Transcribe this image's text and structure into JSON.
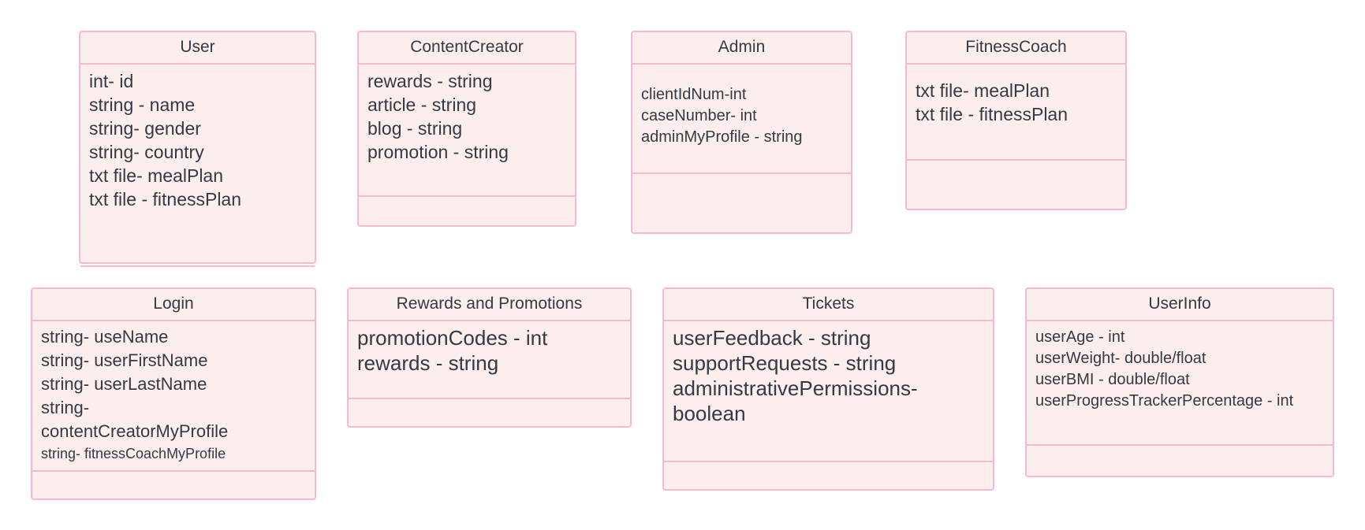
{
  "diagram": {
    "classes": {
      "user": {
        "name": "User",
        "attributes": [
          "int- id",
          "string - name",
          "string- gender",
          "string- country",
          "txt file- mealPlan",
          "txt file - fitnessPlan"
        ]
      },
      "content_creator": {
        "name": "ContentCreator",
        "attributes": [
          "rewards - string",
          "article - string",
          "blog - string",
          "promotion - string"
        ]
      },
      "admin": {
        "name": "Admin",
        "attributes": [
          "clientIdNum-int",
          "caseNumber- int",
          "adminMyProfile - string"
        ]
      },
      "fitness_coach": {
        "name": "FitnessCoach",
        "attributes": [
          "txt file- mealPlan",
          "txt file - fitnessPlan"
        ]
      },
      "login": {
        "name": "Login",
        "attributes": [
          "string- useName",
          "string- userFirstName",
          "string- userLastName",
          "string-",
          "contentCreatorMyProfile",
          "string- fitnessCoachMyProfile"
        ]
      },
      "rewards_promotions": {
        "name": "Rewards and Promotions",
        "attributes": [
          "promotionCodes - int",
          "rewards - string"
        ]
      },
      "tickets": {
        "name": "Tickets",
        "attributes": [
          "userFeedback - string",
          "supportRequests - string",
          "administrativePermissions-",
          "boolean"
        ]
      },
      "user_info": {
        "name": "UserInfo",
        "attributes": [
          "userAge - int",
          "userWeight- double/float",
          "userBMI - double/float",
          "userProgressTrackerPercentage - int"
        ]
      }
    },
    "colors": {
      "box_fill": "#fdeeee",
      "box_border": "#f6b8d2",
      "text": "#333a44"
    }
  }
}
